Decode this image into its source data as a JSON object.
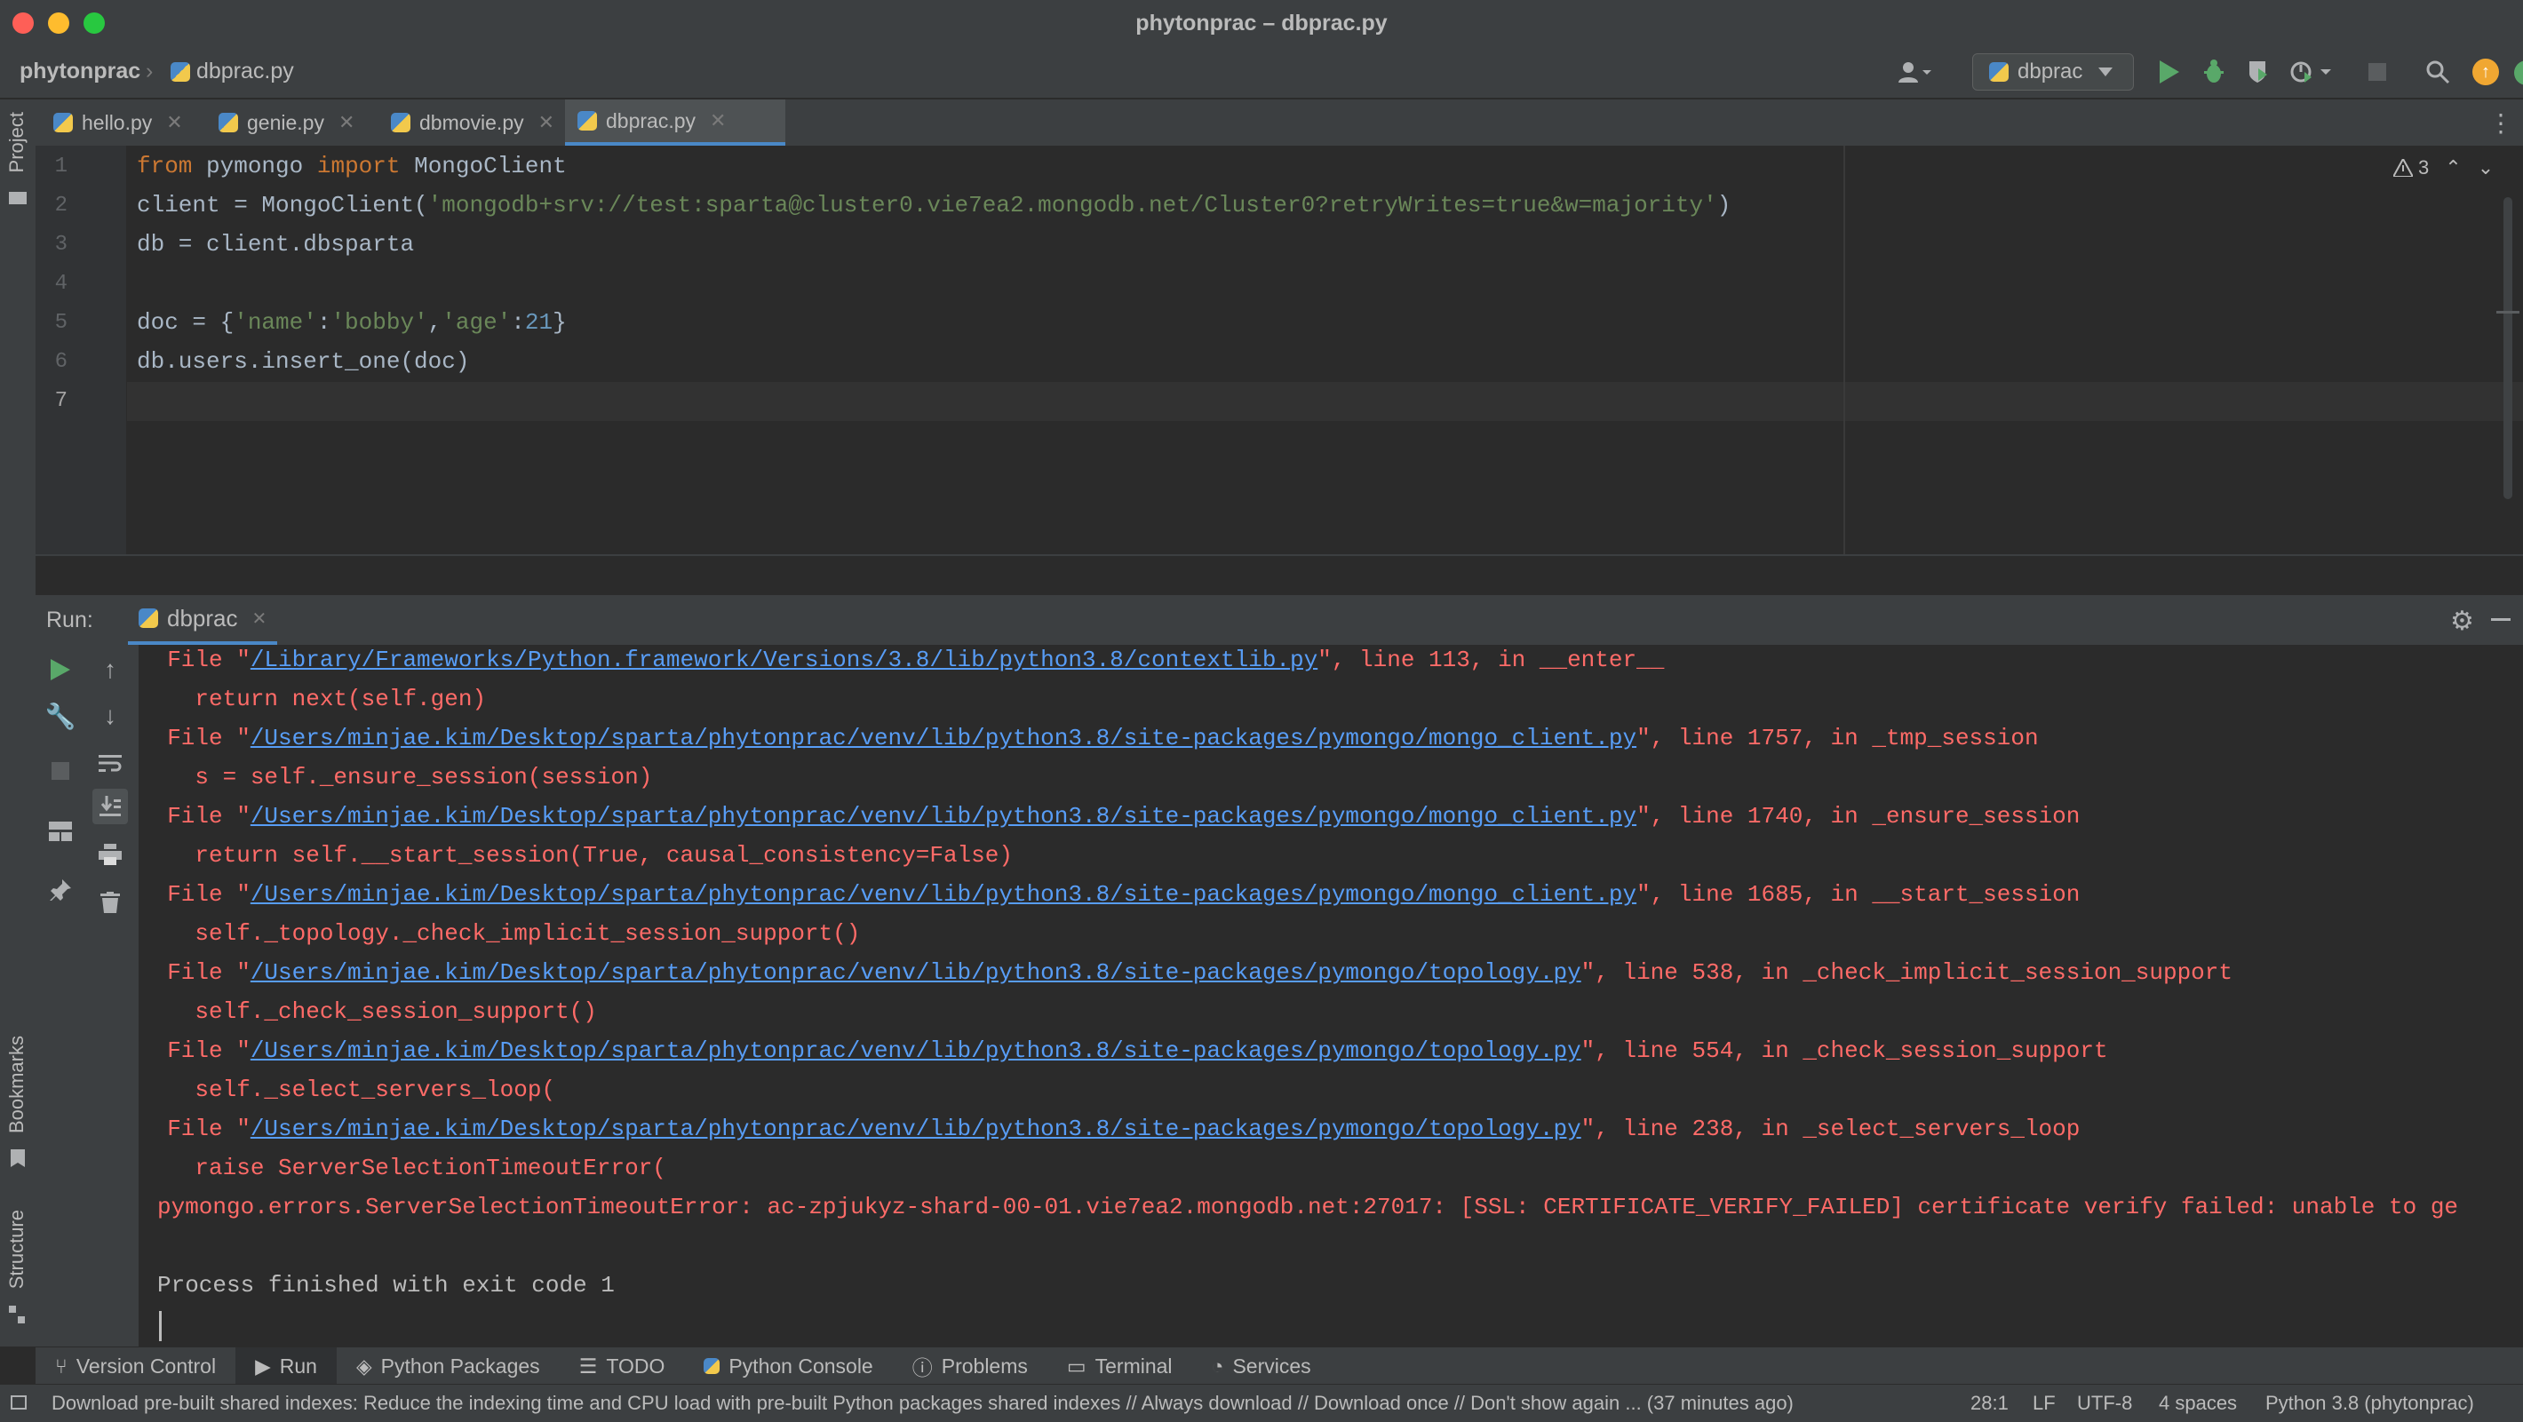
{
  "window": {
    "title": "phytonprac – dbprac.py"
  },
  "nav": {
    "project": "phytonprac",
    "file": "dbprac.py",
    "run_config": "dbprac"
  },
  "tabs": [
    {
      "label": "hello.py",
      "active": false
    },
    {
      "label": "genie.py",
      "active": false
    },
    {
      "label": "dbmovie.py",
      "active": false
    },
    {
      "label": "dbprac.py",
      "active": true
    }
  ],
  "left_strip": {
    "project": "Project",
    "bookmarks": "Bookmarks",
    "structure": "Structure"
  },
  "editor": {
    "line_numbers": [
      "1",
      "2",
      "3",
      "4",
      "5",
      "6",
      "7"
    ],
    "line1": {
      "kw1": "from",
      "mod": " pymongo ",
      "kw2": "import",
      "rest": " MongoClient"
    },
    "line2": {
      "pre": "client = MongoClient(",
      "str": "'mongodb+srv://test:sparta@cluster0.vie7ea2.mongodb.net/Cluster0?retryWrites=true&w=majority'",
      "post": ")"
    },
    "line3": "db = client.dbsparta",
    "line5": {
      "pre": "doc = {",
      "k1": "'name'",
      "c1": ":",
      "v1": "'bobby'",
      "c2": ",",
      "k2": "'age'",
      "c3": ":",
      "v2": "21",
      "post": "}"
    },
    "line6": "db.users.insert_one(doc)",
    "warnings": "3"
  },
  "run": {
    "label": "Run:",
    "tab": "dbprac",
    "lines": [
      {
        "type": "file",
        "pre": "  File \"",
        "link": "/Library/Frameworks/Python.framework/Versions/3.8/lib/python3.8/contextlib.py",
        "post": "\", line 113, in __enter__"
      },
      {
        "type": "code",
        "text": "    return next(self.gen)"
      },
      {
        "type": "file",
        "pre": "  File \"",
        "link": "/Users/minjae.kim/Desktop/sparta/phytonprac/venv/lib/python3.8/site-packages/pymongo/mongo_client.py",
        "post": "\", line 1757, in _tmp_session"
      },
      {
        "type": "code",
        "text": "    s = self._ensure_session(session)"
      },
      {
        "type": "file",
        "pre": "  File \"",
        "link": "/Users/minjae.kim/Desktop/sparta/phytonprac/venv/lib/python3.8/site-packages/pymongo/mongo_client.py",
        "post": "\", line 1740, in _ensure_session"
      },
      {
        "type": "code",
        "text": "    return self.__start_session(True, causal_consistency=False)"
      },
      {
        "type": "file",
        "pre": "  File \"",
        "link": "/Users/minjae.kim/Desktop/sparta/phytonprac/venv/lib/python3.8/site-packages/pymongo/mongo_client.py",
        "post": "\", line 1685, in __start_session"
      },
      {
        "type": "code",
        "text": "    self._topology._check_implicit_session_support()"
      },
      {
        "type": "file",
        "pre": "  File \"",
        "link": "/Users/minjae.kim/Desktop/sparta/phytonprac/venv/lib/python3.8/site-packages/pymongo/topology.py",
        "post": "\", line 538, in _check_implicit_session_support"
      },
      {
        "type": "code",
        "text": "    self._check_session_support()"
      },
      {
        "type": "file",
        "pre": "  File \"",
        "link": "/Users/minjae.kim/Desktop/sparta/phytonprac/venv/lib/python3.8/site-packages/pymongo/topology.py",
        "post": "\", line 554, in _check_session_support"
      },
      {
        "type": "code",
        "text": "    self._select_servers_loop("
      },
      {
        "type": "file",
        "pre": "  File \"",
        "link": "/Users/minjae.kim/Desktop/sparta/phytonprac/venv/lib/python3.8/site-packages/pymongo/topology.py",
        "post": "\", line 238, in _select_servers_loop"
      },
      {
        "type": "code",
        "text": "    raise ServerSelectionTimeoutError("
      },
      {
        "type": "error",
        "text": "pymongo.errors.ServerSelectionTimeoutError: ac-zpjukyz-shard-00-01.vie7ea2.mongodb.net:27017: [SSL: CERTIFICATE_VERIFY_FAILED] certificate verify failed: unable to ge"
      },
      {
        "type": "blank",
        "text": ""
      },
      {
        "type": "normal",
        "text": "Process finished with exit code 1"
      }
    ]
  },
  "bottom_tabs": [
    {
      "label": "Version Control",
      "icon": "branch-icon"
    },
    {
      "label": "Run",
      "icon": "play-icon"
    },
    {
      "label": "Python Packages",
      "icon": "layers-icon"
    },
    {
      "label": "TODO",
      "icon": "list-icon"
    },
    {
      "label": "Python Console",
      "icon": "python-icon"
    },
    {
      "label": "Problems",
      "icon": "info-icon"
    },
    {
      "label": "Terminal",
      "icon": "terminal-icon"
    },
    {
      "label": "Services",
      "icon": "services-icon"
    }
  ],
  "status": {
    "message": "Download pre-built shared indexes: Reduce the indexing time and CPU load with pre-built Python packages shared indexes // Always download // Download once // Don't show again ... (37 minutes ago)",
    "position": "28:1",
    "line_sep": "LF",
    "encoding": "UTF-8",
    "indent": "4 spaces",
    "interpreter": "Python 3.8 (phytonprac)"
  },
  "colors": {
    "accent": "#4a88c7",
    "error": "#ff6b68",
    "link": "#589df6",
    "run_green": "#59a869"
  }
}
